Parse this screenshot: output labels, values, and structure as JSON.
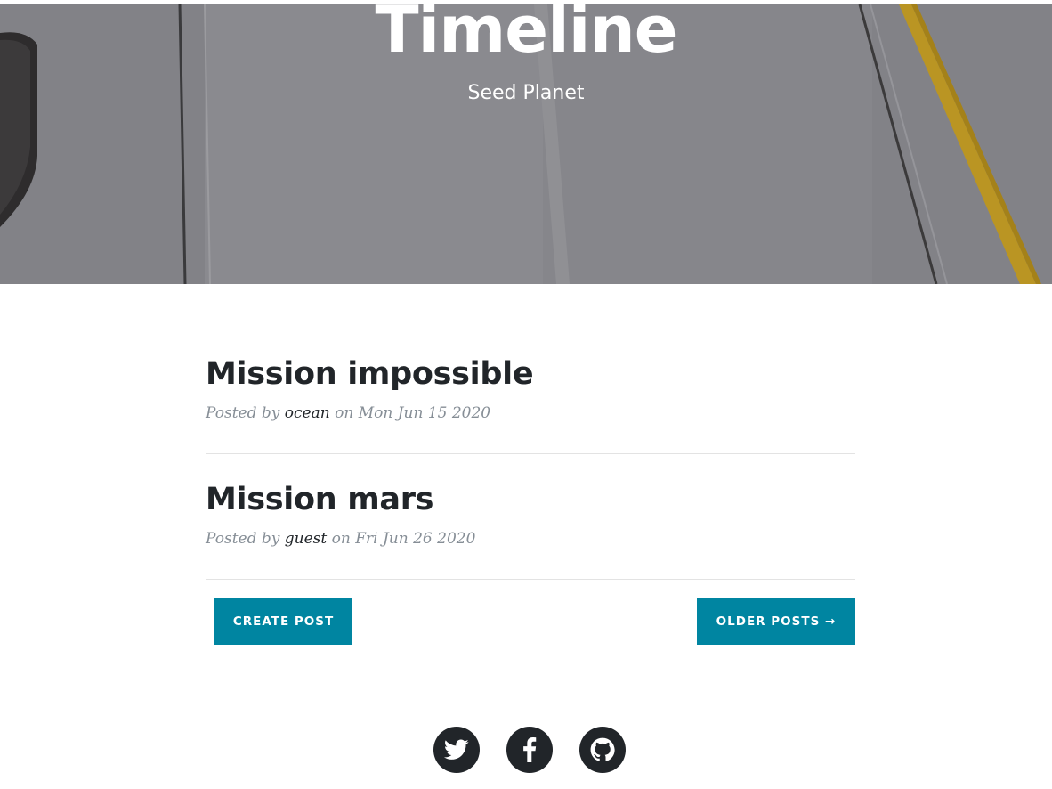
{
  "masthead": {
    "title": "Timeline",
    "subtitle": "Seed Planet"
  },
  "posts": [
    {
      "title": "Mission impossible",
      "meta_prefix": "Posted by ",
      "author": "ocean",
      "meta_on": " on ",
      "date": "Mon Jun 15 2020"
    },
    {
      "title": "Mission mars",
      "meta_prefix": "Posted by ",
      "author": "guest",
      "meta_on": " on ",
      "date": "Fri Jun 26 2020"
    }
  ],
  "actions": {
    "create_label": "CREATE POST",
    "older_label": "OLDER POSTS →"
  },
  "footer": {
    "social": [
      {
        "icon": "twitter-icon"
      },
      {
        "icon": "facebook-icon"
      },
      {
        "icon": "github-icon"
      }
    ]
  },
  "colors": {
    "accent": "#0085a1",
    "heading": "#212529",
    "meta": "#868e96"
  }
}
